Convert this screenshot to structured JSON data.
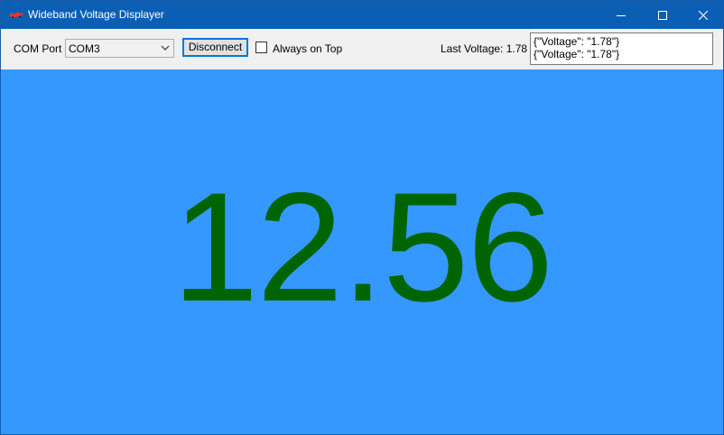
{
  "window": {
    "title": "Wideband Voltage Displayer",
    "icon": "wideband-app-icon"
  },
  "caption_buttons": {
    "minimize_icon": "minimize-icon",
    "maximize_icon": "maximize-icon",
    "close_icon": "close-icon"
  },
  "toolbar": {
    "com_port_label": "COM Port",
    "com_port_selected": "COM3",
    "connect_button_label": "Disconnect",
    "always_on_top_label": "Always on Top",
    "always_on_top_checked": false,
    "last_voltage_label": "Last Voltage: 1.78",
    "log_lines": [
      "{\"Voltage\": \"1.78\"}",
      "{\"Voltage\": \"1.78\"}"
    ]
  },
  "display": {
    "value": "12.56",
    "value_color": "#006400",
    "background_color": "#3598fe"
  },
  "colors": {
    "titlebar": "#0a5fb4",
    "toolbar": "#f0f0f0",
    "button_focus_border": "#0078d7"
  }
}
